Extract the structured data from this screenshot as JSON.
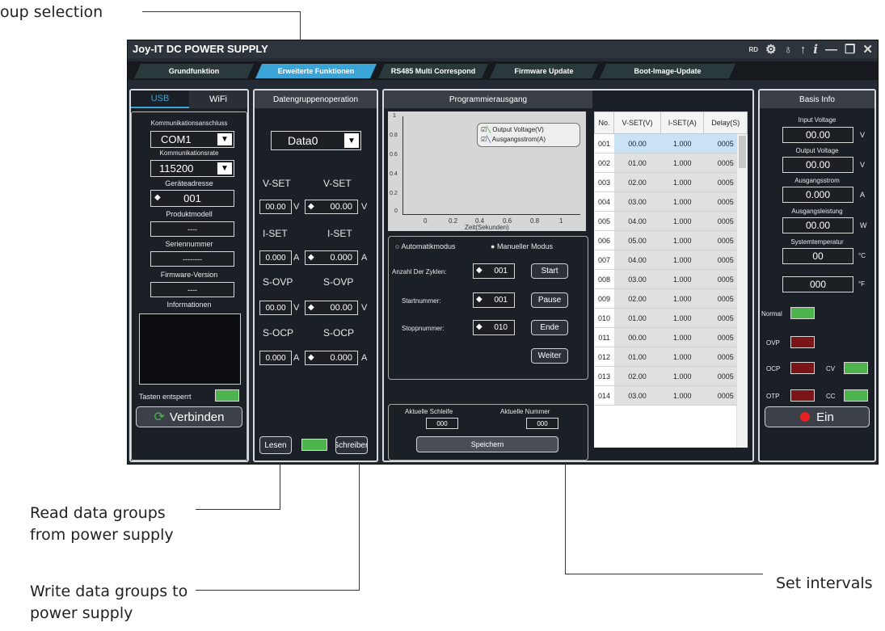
{
  "callouts": {
    "group_selection": "oup selection",
    "read": [
      "Read data groups",
      "from power supply"
    ],
    "write": [
      "Write data groups to",
      "power supply"
    ],
    "intervals": "Set intervals"
  },
  "window": {
    "title": "Joy-IT DC POWER SUPPLY",
    "title_icons": [
      "RD",
      "gear-icon",
      "bulb-icon",
      "upload-icon",
      "info-icon",
      "minimize-icon",
      "restore-icon",
      "close-icon"
    ]
  },
  "tabs": [
    "Grundfunktion",
    "Erweiterte Funktionen",
    "RS485 Multi Correspond",
    "Firmware Update",
    "Boot-Image-Update"
  ],
  "left": {
    "usb": "USB",
    "wifi": "WiFi",
    "port_label": "Kommunikationsanschluss",
    "port_value": "COM1",
    "rate_label": "Kommunikationsrate",
    "rate_value": "115200",
    "addr_label": "Geräteadresse",
    "addr_value": "001",
    "model_label": "Produktmodell",
    "model_value": "----",
    "serial_label": "Seriennummer",
    "serial_value": "--------",
    "fw_label": "Firmware-Version",
    "fw_value": "----",
    "info_label": "Informationen",
    "keys_label": "Tasten entsperrt",
    "connect": "Verbinden"
  },
  "data_group": {
    "header": "Datengruppenoperation",
    "selected": "Data0",
    "vset": "V-SET",
    "iset": "I-SET",
    "sovp": "S-OVP",
    "socp": "S-OCP",
    "v_value": "00.00",
    "a_value": "0.000",
    "unit_v": "V",
    "unit_a": "A",
    "read_btn": "Lesen",
    "write_btn": "Schreiben"
  },
  "program": {
    "header": "Programmierausgang",
    "legend_v": "Output Voltage(V)",
    "legend_a": "Ausgangsstrom(A)",
    "y_ticks": [
      "1",
      "0.8",
      "0.6",
      "0.4",
      "0.2",
      "0"
    ],
    "x_ticks": [
      "0",
      "0.2",
      "0.4",
      "0.6",
      "0.8",
      "1"
    ],
    "x_label": "Zeit(Sekunden)",
    "auto_mode": "Automatikmodus",
    "manual_mode": "Manueller Modus",
    "cycles_label": "Anzahl Der Zyklen:",
    "cycles_value": "001",
    "start_num_label": "Startnummer:",
    "start_num_value": "001",
    "stop_num_label": "Stoppnummer:",
    "stop_num_value": "010",
    "btn_start": "Start",
    "btn_pause": "Pause",
    "btn_end": "Ende",
    "btn_next": "Weiter",
    "cur_loop_label": "Aktuelle Schleife",
    "cur_loop_value": "000",
    "cur_num_label": "Aktuelle Nummer",
    "cur_num_value": "000",
    "save": "Speichern",
    "table_headers": [
      "No.",
      "V-SET(V)",
      "I-SET(A)",
      "Delay(S)"
    ],
    "rows": [
      [
        "001",
        "00.00",
        "1.000",
        "0005"
      ],
      [
        "002",
        "01.00",
        "1.000",
        "0005"
      ],
      [
        "003",
        "02.00",
        "1.000",
        "0005"
      ],
      [
        "004",
        "03.00",
        "1.000",
        "0005"
      ],
      [
        "005",
        "04.00",
        "1.000",
        "0005"
      ],
      [
        "006",
        "05.00",
        "1.000",
        "0005"
      ],
      [
        "007",
        "04.00",
        "1.000",
        "0005"
      ],
      [
        "008",
        "03.00",
        "1.000",
        "0005"
      ],
      [
        "009",
        "02.00",
        "1.000",
        "0005"
      ],
      [
        "010",
        "01.00",
        "1.000",
        "0005"
      ],
      [
        "011",
        "00.00",
        "1.000",
        "0005"
      ],
      [
        "012",
        "01.00",
        "1.000",
        "0005"
      ],
      [
        "013",
        "02.00",
        "1.000",
        "0005"
      ],
      [
        "014",
        "03.00",
        "1.000",
        "0005"
      ]
    ]
  },
  "basis": {
    "header": "Basis Info",
    "input_voltage_label": "Input Voltage",
    "input_voltage": "00.00",
    "output_voltage_label": "Output Voltage",
    "output_voltage": "00.00",
    "current_label": "Ausgangsstrom",
    "current": "0.000",
    "power_label": "Ausgangsleistung",
    "power": "00.00",
    "temp_label": "Systemtemperatur",
    "temp_c": "00",
    "temp_f": "000",
    "unit_v": "V",
    "unit_a": "A",
    "unit_w": "W",
    "unit_c": "°C",
    "unit_f": "°F",
    "normal": "Normal",
    "ovp": "OVP",
    "ocp": "OCP",
    "otp": "OTP",
    "cv": "CV",
    "cc": "CC",
    "power_btn": "Ein",
    "colors": {
      "green": "#4db34d",
      "red": "#7a1518",
      "accent": "#3aa4d6"
    }
  }
}
